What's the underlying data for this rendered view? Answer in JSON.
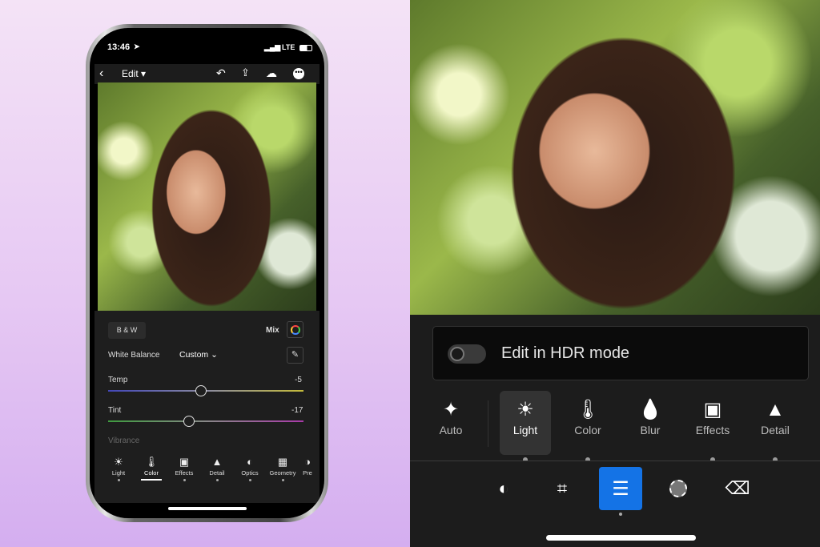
{
  "phone": {
    "status": {
      "time": "13:46",
      "network": "LTE"
    },
    "nav": {
      "title": "Edit"
    },
    "color_panel": {
      "bw_label": "B & W",
      "mix_label": "Mix",
      "white_balance_label": "White Balance",
      "white_balance_value": "Custom",
      "sliders": [
        {
          "label": "Temp",
          "value": "-5"
        },
        {
          "label": "Tint",
          "value": "-17"
        }
      ],
      "vibrance_label": "Vibrance"
    },
    "tools": [
      {
        "label": "Light",
        "icon": "☀"
      },
      {
        "label": "Color",
        "icon": "🌡"
      },
      {
        "label": "Effects",
        "icon": "▣"
      },
      {
        "label": "Detail",
        "icon": "▲"
      },
      {
        "label": "Optics",
        "icon": "◐"
      },
      {
        "label": "Geometry",
        "icon": "▦"
      },
      {
        "label": "Pre",
        "icon": "◑"
      }
    ],
    "active_tool": "Color"
  },
  "app": {
    "hdr_label": "Edit in HDR mode",
    "hdr_enabled": false,
    "tools": [
      {
        "label": "Auto",
        "icon": "✦"
      },
      {
        "label": "Light",
        "icon": "☀"
      },
      {
        "label": "Color",
        "icon": "🌡"
      },
      {
        "label": "Blur",
        "icon": "💧"
      },
      {
        "label": "Effects",
        "icon": "▣"
      },
      {
        "label": "Detail",
        "icon": "▲"
      }
    ],
    "active_tool": "Light",
    "accent": "#1473e6"
  }
}
